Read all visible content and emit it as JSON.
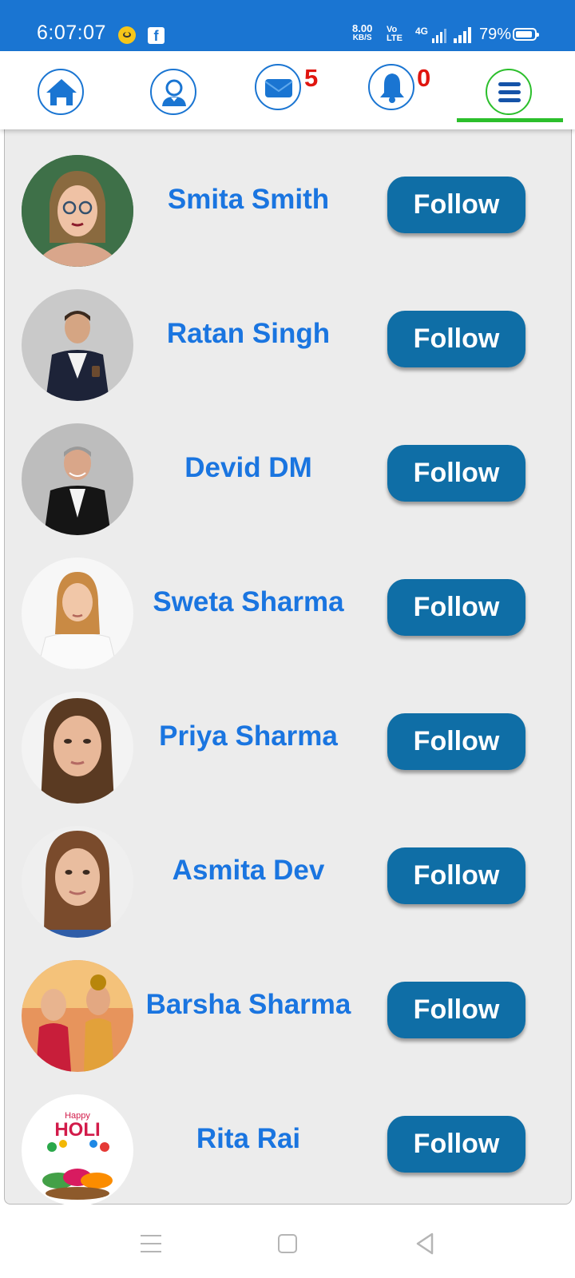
{
  "status_bar": {
    "time": "6:07:07",
    "speed_value": "8.00",
    "speed_unit": "KB/S",
    "volte": "Vo LTE",
    "network": "4G",
    "battery": "79%"
  },
  "nav": {
    "message_count": "5",
    "notification_count": "0"
  },
  "users": [
    {
      "name": "Smita Smith",
      "button": "Follow"
    },
    {
      "name": "Ratan Singh",
      "button": "Follow"
    },
    {
      "name": "Devid DM",
      "button": "Follow"
    },
    {
      "name": "Sweta Sharma",
      "button": "Follow"
    },
    {
      "name": "Priya Sharma",
      "button": "Follow"
    },
    {
      "name": "Asmita Dev",
      "button": "Follow"
    },
    {
      "name": "Barsha Sharma",
      "button": "Follow"
    },
    {
      "name": "Rita Rai",
      "button": "Follow",
      "avatar_text": "HOLI",
      "avatar_small_text": "Happy"
    }
  ],
  "colors": {
    "status_bar": "#1a75d2",
    "accent_blue": "#1a75e0",
    "follow_button": "#0f6ea6",
    "badge_red": "#e0150f",
    "active_green": "#2cbf2c",
    "panel_bg": "#ececec"
  }
}
